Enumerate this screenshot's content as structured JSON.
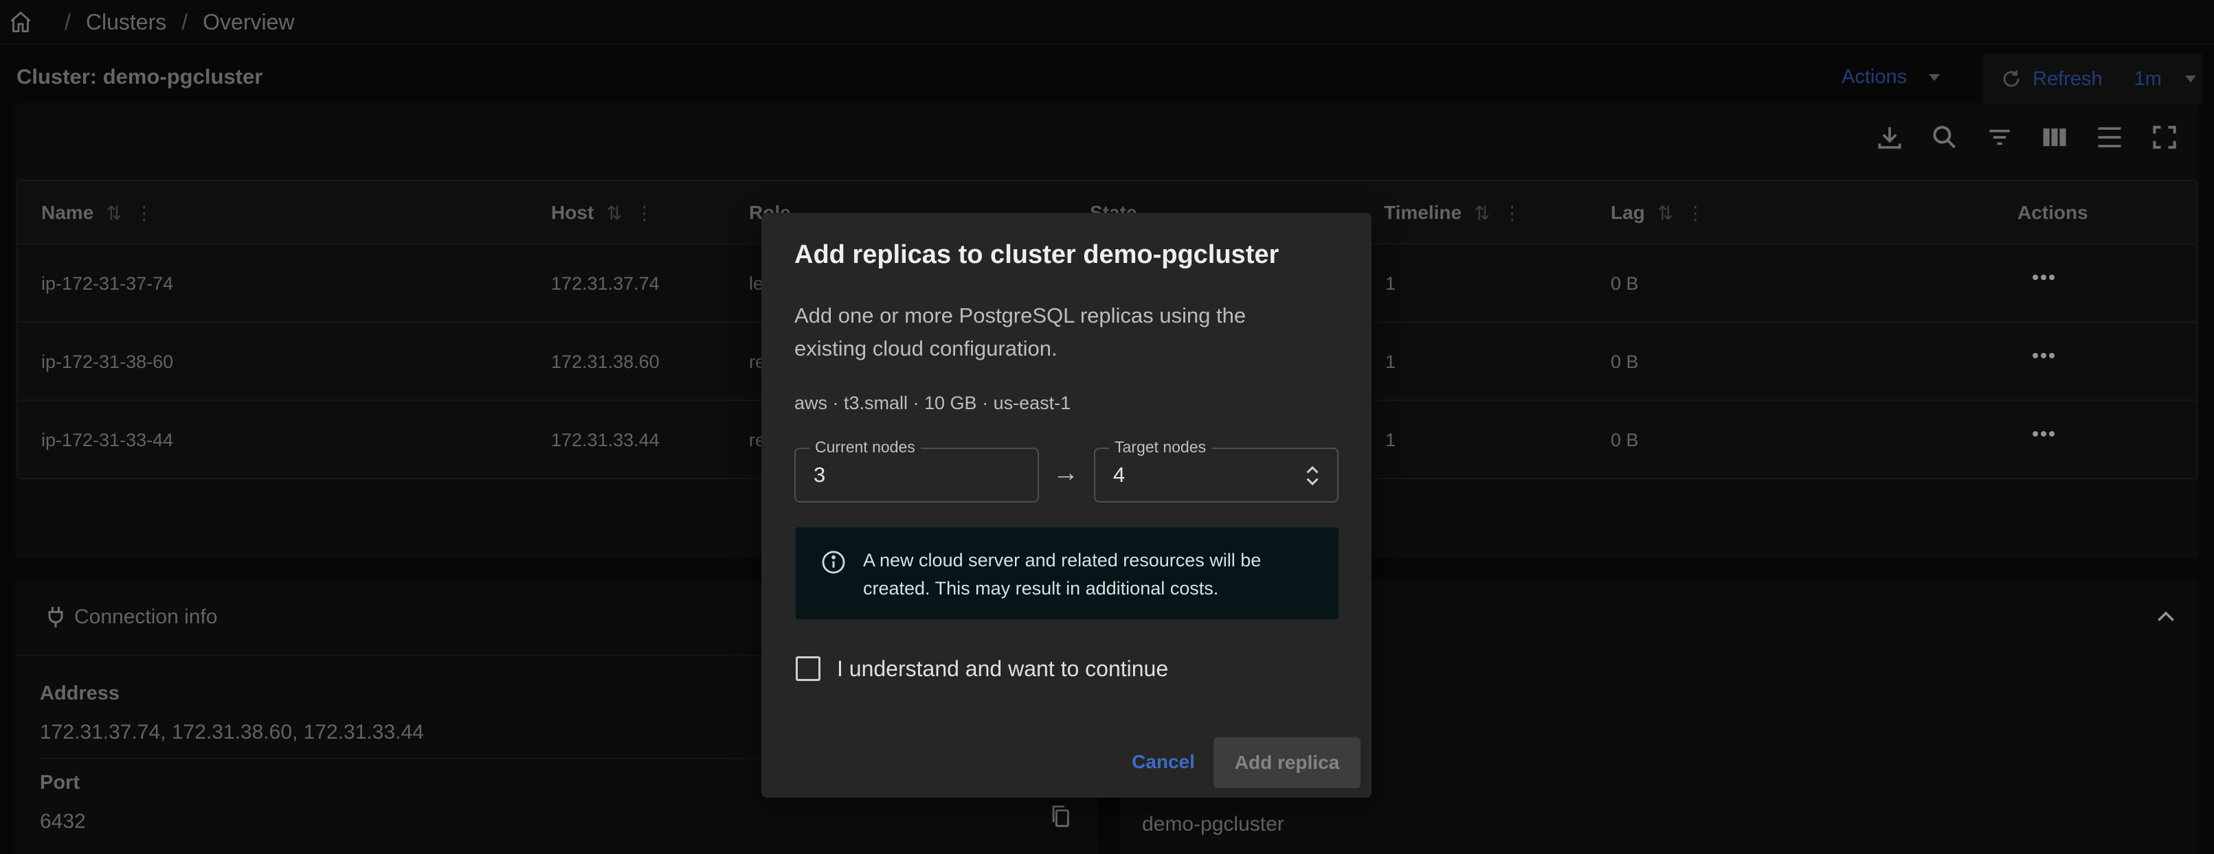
{
  "breadcrumb": {
    "items": [
      "Clusters",
      "Overview"
    ]
  },
  "header": {
    "title": "Cluster: demo-pgcluster",
    "actions_label": "Actions",
    "refresh_label": "Refresh",
    "refresh_interval": "1m"
  },
  "table": {
    "columns": [
      "Name",
      "Host",
      "Role",
      "State",
      "Timeline",
      "Lag",
      "Actions"
    ],
    "rows": [
      {
        "name": "ip-172-31-37-74",
        "host": "172.31.37.74",
        "role": "le",
        "timeline": "1",
        "lag": "0 B"
      },
      {
        "name": "ip-172-31-38-60",
        "host": "172.31.38.60",
        "role": "re",
        "timeline": "1",
        "lag": "0 B"
      },
      {
        "name": "ip-172-31-33-44",
        "host": "172.31.33.44",
        "role": "re",
        "timeline": "1",
        "lag": "0 B"
      }
    ]
  },
  "connection": {
    "title": "Connection info",
    "address_label": "Address",
    "address_value": "172.31.37.74, 172.31.38.60, 172.31.33.44",
    "port_label": "Port",
    "port_value": "6432"
  },
  "right_panel": {
    "value": "demo-pgcluster"
  },
  "dialog": {
    "title": "Add replicas to cluster demo-pgcluster",
    "description": "Add one or more PostgreSQL replicas using the existing cloud configuration.",
    "spec": "aws · t3.small · 10 GB · us-east-1",
    "current_label": "Current nodes",
    "current_value": "3",
    "arrow": "→",
    "target_label": "Target nodes",
    "target_value": "4",
    "info": "A new cloud server and related resources will be created. This may result in additional costs.",
    "checkbox_label": "I understand and want to continue",
    "cancel_label": "Cancel",
    "submit_label": "Add replica"
  },
  "colors": {
    "accent": "#3d6bc6",
    "dialog_bg": "#262626",
    "info_bg": "#071418"
  }
}
